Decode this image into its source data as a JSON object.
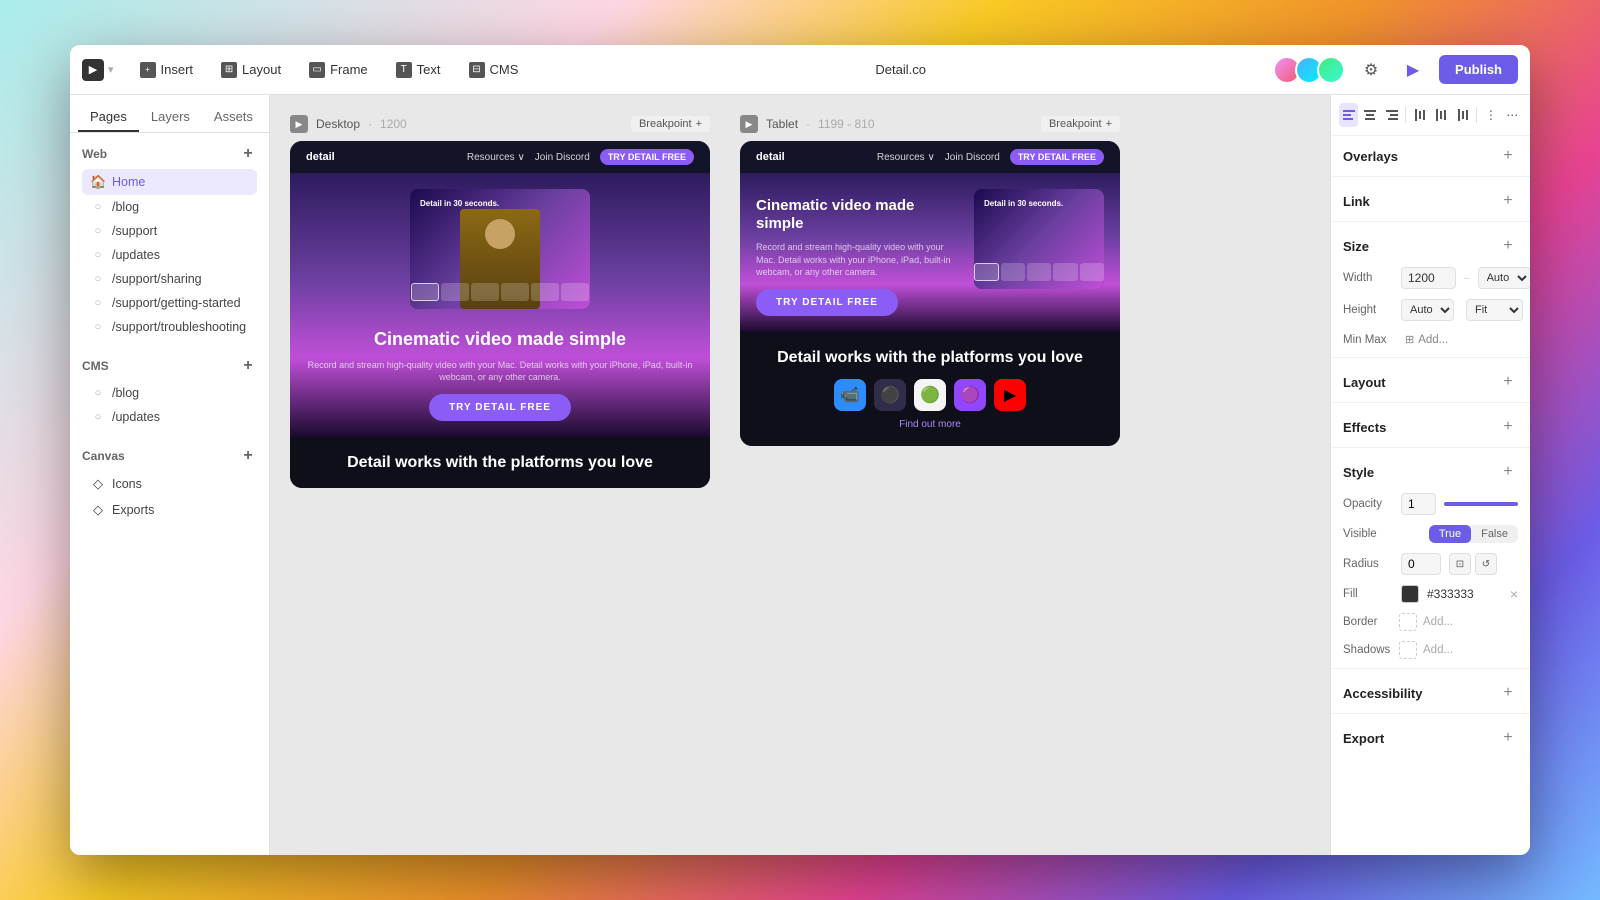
{
  "toolbar": {
    "logo_label": "▶",
    "insert_label": "Insert",
    "layout_label": "Layout",
    "frame_label": "Frame",
    "text_label": "Text",
    "cms_label": "CMS",
    "title": "Detail.co",
    "publish_label": "Publish"
  },
  "sidebar": {
    "tabs": [
      "Pages",
      "Layers",
      "Assets"
    ],
    "active_tab": "Pages",
    "sections": {
      "web": {
        "title": "Web",
        "items": [
          {
            "label": "Home",
            "icon": "🏠",
            "active": true
          },
          {
            "label": "/blog",
            "icon": "○"
          },
          {
            "label": "/support",
            "icon": "○"
          },
          {
            "label": "/updates",
            "icon": "○"
          },
          {
            "label": "/support/sharing",
            "icon": "○"
          },
          {
            "label": "/support/getting-started",
            "icon": "○"
          },
          {
            "label": "/support/troubleshooting",
            "icon": "○"
          }
        ]
      },
      "cms": {
        "title": "CMS",
        "items": [
          {
            "label": "/blog",
            "icon": "○"
          },
          {
            "label": "/updates",
            "icon": "○"
          }
        ]
      },
      "canvas": {
        "title": "Canvas",
        "items": [
          {
            "label": "Icons",
            "icon": "◇"
          },
          {
            "label": "Exports",
            "icon": "◇"
          }
        ]
      }
    }
  },
  "canvas": {
    "frames": [
      {
        "id": "desktop",
        "label": "Desktop",
        "size": "1200",
        "breakpoint_label": "Breakpoint",
        "content": {
          "nav_logo": "detail",
          "nav_links": [
            "Resources ∨",
            "Join Discord"
          ],
          "try_btn": "TRY DETAIL FREE",
          "hero_text": "Detail in 30 seconds.",
          "headline": "Cinematic video\nmade simple",
          "subtitle": "Record and stream high-quality video with your Mac. Detail works with your iPhone, iPad, built-in webcam, or any other camera.",
          "cta_btn": "TRY DETAIL FREE",
          "platforms_title": "Detail works with\nthe platforms you love"
        }
      },
      {
        "id": "tablet",
        "label": "Tablet",
        "size": "1199 - 810",
        "breakpoint_label": "Breakpoint",
        "content": {
          "nav_logo": "detail",
          "nav_links": [
            "Resources ∨",
            "Join Discord"
          ],
          "try_btn": "TRY DETAIL FREE",
          "hero_text": "Detail in 30 seconds.",
          "headline": "Cinematic video\nmade simple",
          "subtitle": "Record and stream high-quality video with your Mac. Detail works with your iPhone, iPad, built-in webcam, or any other camera.",
          "cta_btn": "TRY DETAIL FREE",
          "platforms_title": "Detail works with\nthe platforms you love",
          "find_out_more": "Find out more"
        }
      }
    ]
  },
  "right_panel": {
    "align_tools": [
      "⬛",
      "⬛",
      "⬛",
      "⬛",
      "⬛",
      "⬛",
      "⬛",
      "⬛"
    ],
    "sections": {
      "overlays": "Overlays",
      "link": "Link",
      "size": "Size",
      "layout": "Layout",
      "effects": "Effects",
      "style": "Style",
      "accessibility": "Accessibility",
      "export": "Export"
    },
    "width_value": "1200",
    "width_unit": "Auto",
    "height_value": "Auto",
    "height_unit": "Fit",
    "min_max_label": "Min Max",
    "opacity_value": "1",
    "visible_true": "True",
    "visible_false": "False",
    "radius_value": "0",
    "fill_value": "#333333",
    "border_add": "Add...",
    "shadows_add": "Add...",
    "fill_label": "Fill",
    "border_label": "Border",
    "shadows_label": "Shadows",
    "opacity_label": "Opacity",
    "visible_label": "Visible",
    "radius_label": "Radius"
  }
}
